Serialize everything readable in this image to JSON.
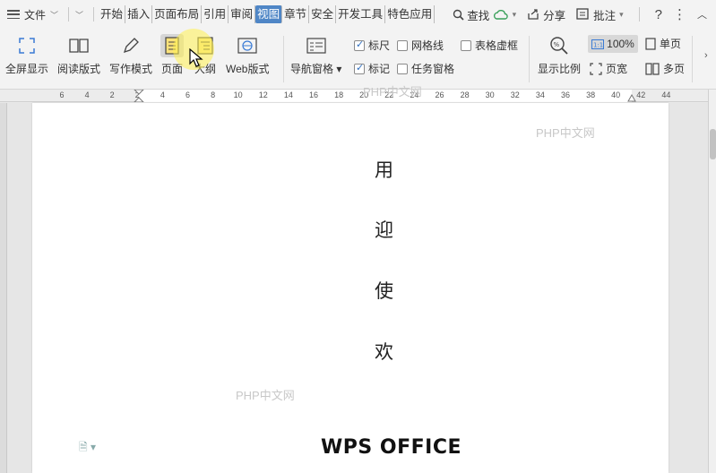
{
  "menubar": {
    "file_label": "文件",
    "tabs": [
      "开始",
      "插入",
      "页面布局",
      "引用",
      "审阅",
      "视图",
      "章节",
      "安全",
      "开发工具",
      "特色应用"
    ],
    "active_tab": "视图",
    "search_label": "查找",
    "share_label": "分享",
    "comment_label": "批注"
  },
  "ribbon": {
    "fullscreen_label": "全屏显示",
    "reading_label": "阅读版式",
    "writing_label": "写作模式",
    "page_label": "页面",
    "outline_label": "大纲",
    "web_label": "Web版式",
    "nav_pane_label": "导航窗格",
    "ruler_label": "标尺",
    "gridlines_label": "网格线",
    "table_gridlines_label": "表格虚框",
    "marks_label": "标记",
    "task_pane_label": "任务窗格",
    "zoom_label": "显示比例",
    "zoom_value": "100%",
    "page_width_label": "页宽",
    "single_page_label": "单页",
    "multi_page_label": "多页",
    "ruler_checked": true,
    "gridlines_checked": false,
    "table_gridlines_checked": false,
    "marks_checked": true,
    "task_pane_checked": false
  },
  "ruler": {
    "ticks": [
      "6",
      "4",
      "2",
      "2",
      "4",
      "6",
      "8",
      "10",
      "12",
      "14",
      "16",
      "18",
      "20",
      "22",
      "24",
      "26",
      "28",
      "30",
      "32",
      "34",
      "36",
      "38",
      "40",
      "42",
      "44"
    ]
  },
  "document": {
    "vertical_chars": [
      "用",
      "迎",
      "使",
      "欢"
    ],
    "title": "WPS OFFICE"
  },
  "watermarks": [
    "PHP中文网",
    "PHP中文网",
    "PHP中文网"
  ]
}
